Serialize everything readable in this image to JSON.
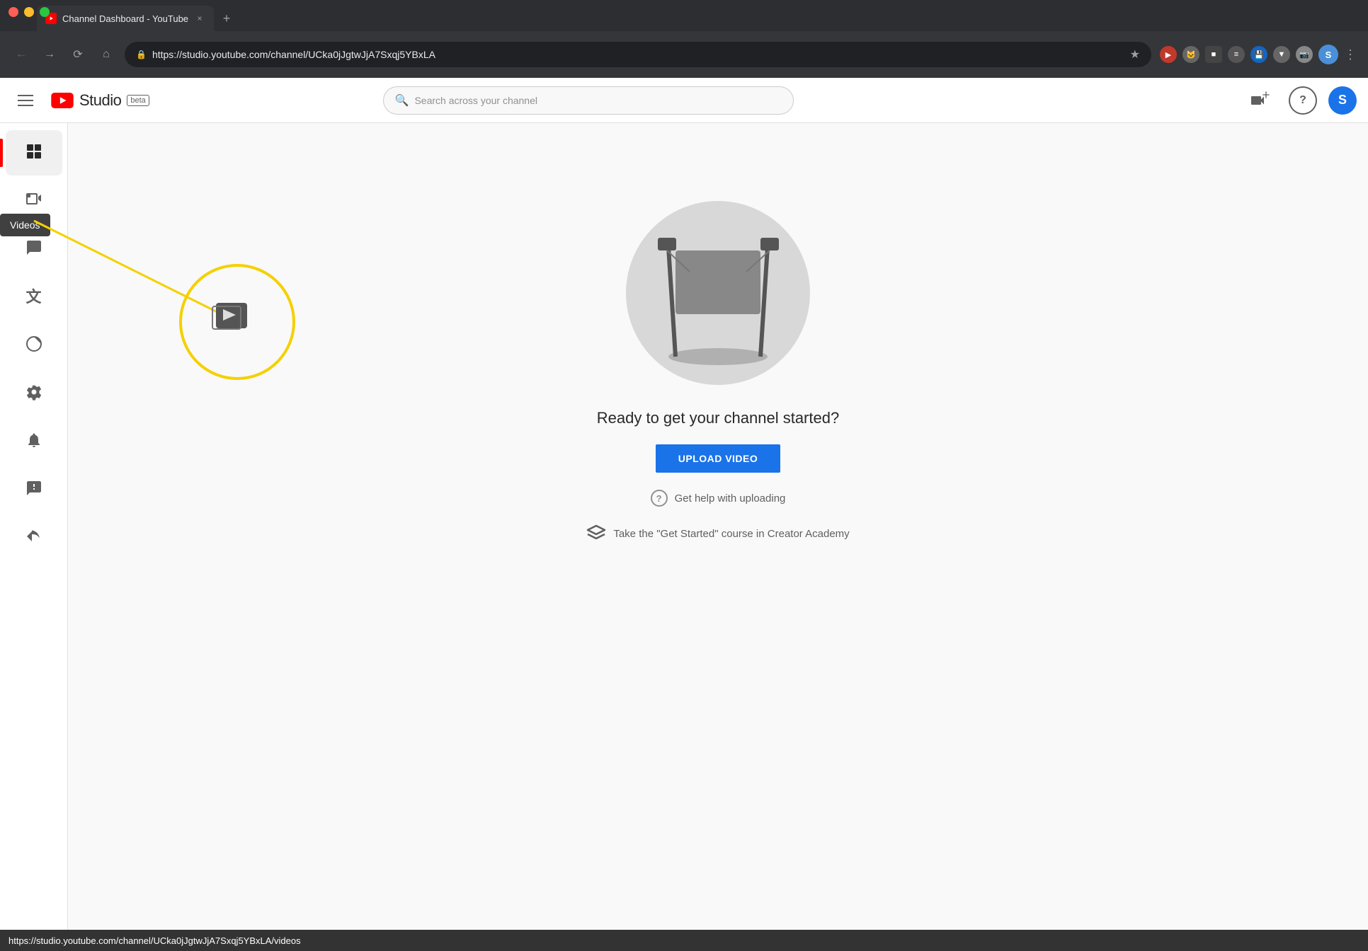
{
  "browser": {
    "tab_title": "Channel Dashboard - YouTube",
    "tab_close": "×",
    "tab_new": "+",
    "address": "https://studio.youtube.com/channel/UCka0jJgtwJjA7Sxqj5YBxLA",
    "search_placeholder": "Search across your channel",
    "window_controls": [
      "red",
      "yellow",
      "green"
    ]
  },
  "header": {
    "studio_label": "Studio",
    "beta_label": "beta",
    "search_placeholder": "Search across your channel"
  },
  "sidebar": {
    "items": [
      {
        "id": "dashboard",
        "label": "Dashboard",
        "active": true
      },
      {
        "id": "videos",
        "label": "Videos",
        "active": false
      },
      {
        "id": "comments",
        "label": "Comments",
        "active": false
      },
      {
        "id": "subtitles",
        "label": "Subtitles",
        "active": false
      },
      {
        "id": "analytics",
        "label": "Analytics",
        "active": false
      },
      {
        "id": "settings",
        "label": "Settings",
        "active": false
      },
      {
        "id": "alerts",
        "label": "Alerts",
        "active": false
      },
      {
        "id": "feedback",
        "label": "Feedback",
        "active": false
      },
      {
        "id": "send",
        "label": "Send",
        "active": false
      }
    ],
    "tooltip_label": "Videos"
  },
  "main": {
    "empty_state_title": "Ready to get your channel started?",
    "upload_button_label": "UPLOAD VIDEO",
    "help_text": "Get help with uploading",
    "creator_academy_text": "Take the \"Get Started\" course in Creator Academy"
  },
  "status_bar": {
    "url": "https://studio.youtube.com/channel/UCka0jJgtwJjA7Sxqj5YBxLA/videos"
  },
  "colors": {
    "yt_red": "#ff0000",
    "upload_btn": "#1a73e8",
    "active_indicator": "#ff0000",
    "tooltip_bg": "#404040",
    "annotation_circle": "#f5d000",
    "annotation_line": "#f5d000"
  }
}
